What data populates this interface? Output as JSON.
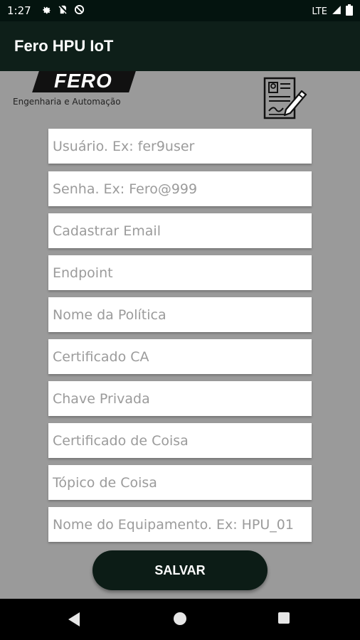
{
  "status_bar": {
    "time": "1:27",
    "network": "LTE",
    "left_icons": [
      "settings-gear-icon",
      "no-sim-icon",
      "dnd-icon"
    ],
    "right_icons": [
      "signal-icon",
      "battery-icon"
    ]
  },
  "app_bar": {
    "title": "Fero HPU IoT"
  },
  "logo": {
    "brand": "FERO",
    "subtitle": "Engenharia e Automação"
  },
  "form": {
    "fields": [
      {
        "placeholder": "Usuário. Ex: fer9user"
      },
      {
        "placeholder": "Senha. Ex: Fero@999"
      },
      {
        "placeholder": "Cadastrar Email"
      },
      {
        "placeholder": "Endpoint"
      },
      {
        "placeholder": "Nome da Política"
      },
      {
        "placeholder": "Certificado CA"
      },
      {
        "placeholder": "Chave Privada"
      },
      {
        "placeholder": "Certificado de Coisa"
      },
      {
        "placeholder": "Tópico de Coisa"
      },
      {
        "placeholder": "Nome do Equipamento. Ex: HPU_01"
      }
    ],
    "save_label": "SALVAR"
  },
  "colors": {
    "status_bar": "#04140f",
    "app_bar": "#0e1f19",
    "background": "#9a9a9a",
    "button": "#0c1c16"
  }
}
